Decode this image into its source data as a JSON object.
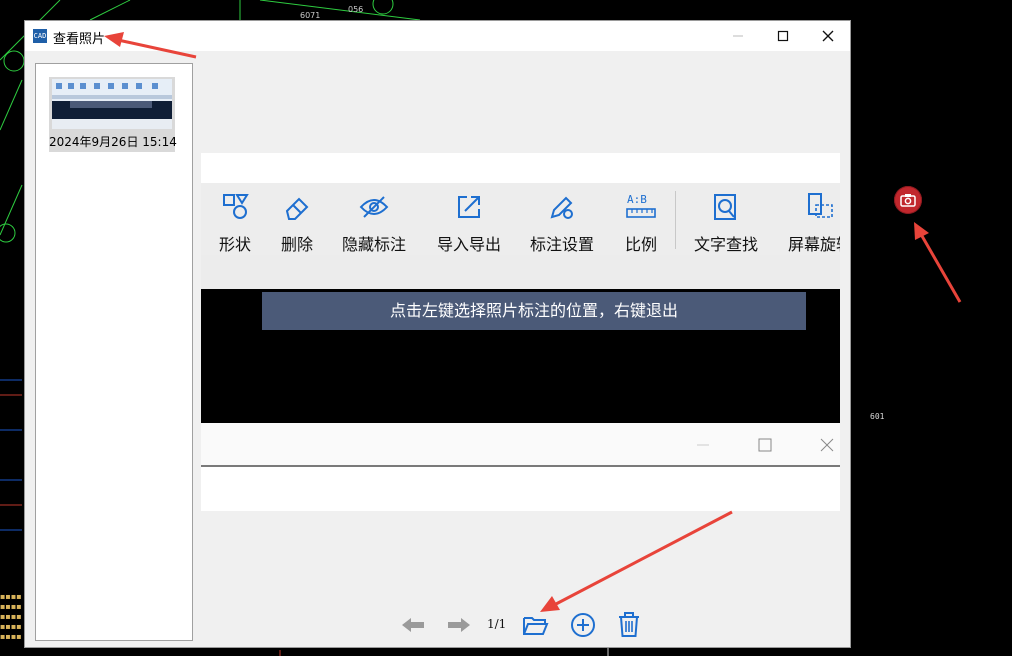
{
  "dialog": {
    "title": "查看照片",
    "minimize_icon": "minimize-icon",
    "maximize_icon": "maximize-icon",
    "close_icon": "close-icon"
  },
  "thumbnails": [
    {
      "label": "2024年9月26日 15:14"
    }
  ],
  "preview": {
    "toolbar": [
      {
        "label": "形状",
        "icon": "shape-icon"
      },
      {
        "label": "删除",
        "icon": "eraser-icon"
      },
      {
        "label": "隐藏标注",
        "icon": "eye-hidden-icon"
      },
      {
        "label": "导入导出",
        "icon": "import-export-icon"
      },
      {
        "label": "标注设置",
        "icon": "pen-settings-icon"
      },
      {
        "label": "比例",
        "icon": "scale-icon"
      },
      {
        "label": "文字查找",
        "icon": "text-search-icon"
      },
      {
        "label": "屏幕旋转",
        "icon": "screen-rotate-icon"
      }
    ],
    "hint": "点击左键选择照片标注的位置，右键退出"
  },
  "nav": {
    "page_indicator": "1/1",
    "prev_icon": "arrow-left-icon",
    "next_icon": "arrow-right-icon",
    "open_icon": "folder-open-icon",
    "add_icon": "plus-circle-icon",
    "delete_icon": "trash-icon"
  },
  "cad": {
    "label": "601",
    "label_top": "6071",
    "label_top2": "056"
  },
  "colors": {
    "annotation_arrow": "#e8443a",
    "camera_button": "#c1272d",
    "hint_bar": "#4b5a78",
    "icon_blue": "#1e6fd0"
  }
}
